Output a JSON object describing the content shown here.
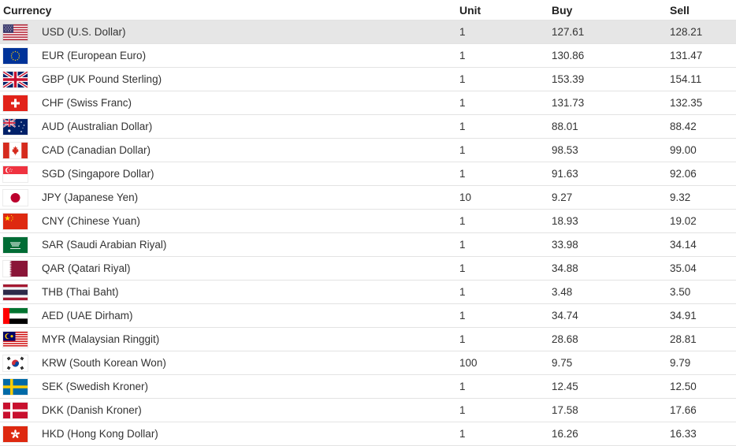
{
  "headers": {
    "currency": "Currency",
    "unit": "Unit",
    "buy": "Buy",
    "sell": "Sell"
  },
  "rows": [
    {
      "flag": "us-flag-icon",
      "currency": "USD (U.S. Dollar)",
      "unit": "1",
      "buy": "127.61",
      "sell": "128.21"
    },
    {
      "flag": "eu-flag-icon",
      "currency": "EUR (European Euro)",
      "unit": "1",
      "buy": "130.86",
      "sell": "131.47"
    },
    {
      "flag": "uk-flag-icon",
      "currency": "GBP (UK Pound Sterling)",
      "unit": "1",
      "buy": "153.39",
      "sell": "154.11"
    },
    {
      "flag": "swiss-flag-icon",
      "currency": "CHF (Swiss Franc)",
      "unit": "1",
      "buy": "131.73",
      "sell": "132.35"
    },
    {
      "flag": "australia-flag-icon",
      "currency": "AUD (Australian Dollar)",
      "unit": "1",
      "buy": "88.01",
      "sell": "88.42"
    },
    {
      "flag": "canada-flag-icon",
      "currency": "CAD (Canadian Dollar)",
      "unit": "1",
      "buy": "98.53",
      "sell": "99.00"
    },
    {
      "flag": "singapore-flag-icon",
      "currency": "SGD (Singapore Dollar)",
      "unit": "1",
      "buy": "91.63",
      "sell": "92.06"
    },
    {
      "flag": "japan-flag-icon",
      "currency": "JPY (Japanese Yen)",
      "unit": "10",
      "buy": "9.27",
      "sell": "9.32"
    },
    {
      "flag": "china-flag-icon",
      "currency": "CNY (Chinese Yuan)",
      "unit": "1",
      "buy": "18.93",
      "sell": "19.02"
    },
    {
      "flag": "saudi-flag-icon",
      "currency": "SAR (Saudi Arabian Riyal)",
      "unit": "1",
      "buy": "33.98",
      "sell": "34.14"
    },
    {
      "flag": "qatar-flag-icon",
      "currency": "QAR (Qatari Riyal)",
      "unit": "1",
      "buy": "34.88",
      "sell": "35.04"
    },
    {
      "flag": "thailand-flag-icon",
      "currency": "THB (Thai Baht)",
      "unit": "1",
      "buy": "3.48",
      "sell": "3.50"
    },
    {
      "flag": "uae-flag-icon",
      "currency": "AED (UAE Dirham)",
      "unit": "1",
      "buy": "34.74",
      "sell": "34.91"
    },
    {
      "flag": "malaysia-flag-icon",
      "currency": "MYR (Malaysian Ringgit)",
      "unit": "1",
      "buy": "28.68",
      "sell": "28.81"
    },
    {
      "flag": "south-korea-flag-icon",
      "currency": "KRW (South Korean Won)",
      "unit": "100",
      "buy": "9.75",
      "sell": "9.79"
    },
    {
      "flag": "sweden-flag-icon",
      "currency": "SEK (Swedish Kroner)",
      "unit": "1",
      "buy": "12.45",
      "sell": "12.50"
    },
    {
      "flag": "denmark-flag-icon",
      "currency": "DKK (Danish Kroner)",
      "unit": "1",
      "buy": "17.58",
      "sell": "17.66"
    },
    {
      "flag": "hong-kong-flag-icon",
      "currency": "HKD (Hong Kong Dollar)",
      "unit": "1",
      "buy": "16.26",
      "sell": "16.33"
    }
  ],
  "colors": {
    "header_text": "#222222",
    "row_divider": "#e3e3e3",
    "highlight_row": "#e6e6e6"
  }
}
